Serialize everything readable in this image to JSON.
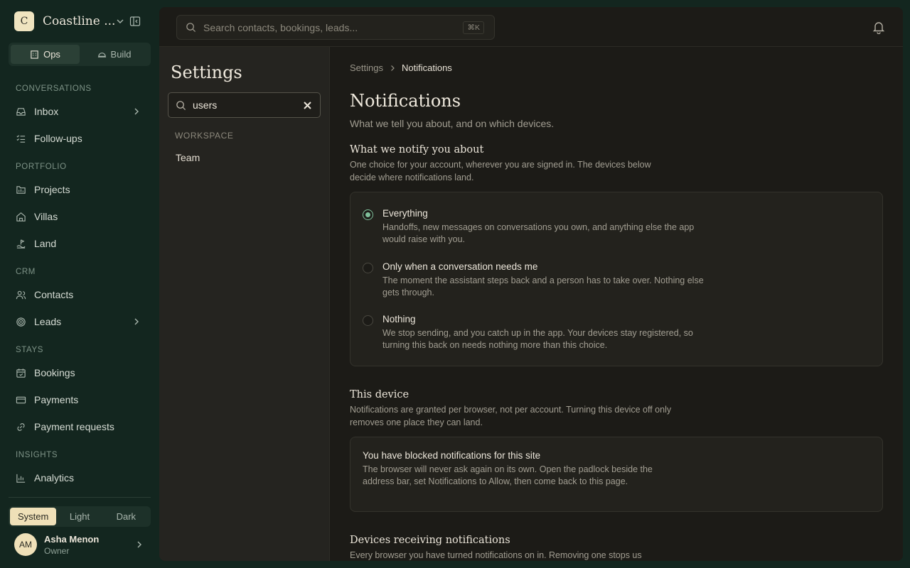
{
  "brand": {
    "initial": "C",
    "name": "Coastline ..."
  },
  "modes": [
    {
      "label": "Ops",
      "active": true,
      "icon": "building-icon"
    },
    {
      "label": "Build",
      "active": false,
      "icon": "hardhat-icon"
    }
  ],
  "nav": {
    "conversations": {
      "title": "CONVERSATIONS",
      "items": [
        {
          "label": "Inbox",
          "icon": "inbox-icon",
          "expandable": true
        },
        {
          "label": "Follow-ups",
          "icon": "checklist-icon",
          "expandable": false
        }
      ]
    },
    "portfolio": {
      "title": "PORTFOLIO",
      "items": [
        {
          "label": "Projects",
          "icon": "folder-icon"
        },
        {
          "label": "Villas",
          "icon": "home-icon"
        },
        {
          "label": "Land",
          "icon": "land-icon"
        }
      ]
    },
    "crm": {
      "title": "CRM",
      "items": [
        {
          "label": "Contacts",
          "icon": "users-icon"
        },
        {
          "label": "Leads",
          "icon": "target-icon",
          "expandable": true
        }
      ]
    },
    "stays": {
      "title": "STAYS",
      "items": [
        {
          "label": "Bookings",
          "icon": "calendar-icon"
        },
        {
          "label": "Payments",
          "icon": "card-icon"
        },
        {
          "label": "Payment requests",
          "icon": "link-icon"
        }
      ]
    },
    "insights": {
      "title": "INSIGHTS",
      "items": [
        {
          "label": "Analytics",
          "icon": "chart-icon"
        }
      ]
    }
  },
  "theme": {
    "options": [
      "System",
      "Light",
      "Dark"
    ],
    "selected": "System"
  },
  "user": {
    "initials": "AM",
    "name": "Asha Menon",
    "role": "Owner"
  },
  "topbar": {
    "search_placeholder": "Search contacts, bookings, leads...",
    "shortcut": "⌘K"
  },
  "settings": {
    "title": "Settings",
    "search_value": "users",
    "group": "WORKSPACE",
    "link": "Team"
  },
  "breadcrumb": {
    "parent": "Settings",
    "current": "Notifications"
  },
  "page": {
    "title": "Notifications",
    "subtitle": "What we tell you about, and on which devices."
  },
  "notify_section": {
    "title": "What we notify you about",
    "description": "One choice for your account, wherever you are signed in. The devices below decide where notifications land.",
    "options": [
      {
        "label": "Everything",
        "description": "Handoffs, new messages on conversations you own, and anything else the app would raise with you.",
        "checked": true
      },
      {
        "label": "Only when a conversation needs me",
        "description": "The moment the assistant steps back and a person has to take over. Nothing else gets through.",
        "checked": false
      },
      {
        "label": "Nothing",
        "description": "We stop sending, and you catch up in the app. Your devices stay registered, so turning this back on needs nothing more than this choice.",
        "checked": false
      }
    ]
  },
  "device_section": {
    "title": "This device",
    "description": "Notifications are granted per browser, not per account. Turning this device off only removes one place they can land.",
    "notice_title": "You have blocked notifications for this site",
    "notice_body": "The browser will never ask again on its own. Open the padlock beside the address bar, set Notifications to Allow, then come back to this page."
  },
  "devices_section": {
    "title": "Devices receiving notifications",
    "description": "Every browser you have turned notifications on in. Removing one stops us"
  },
  "colors": {
    "accent": "#7fbf9a",
    "sidebar_bg": "#13261f",
    "panel_bg": "#1c1b17",
    "highlight": "#efe0b8"
  }
}
